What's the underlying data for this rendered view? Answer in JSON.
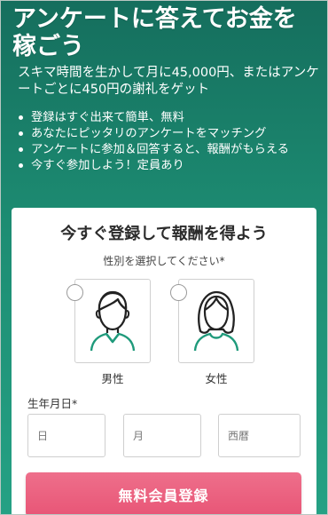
{
  "hero": {
    "headline": "アンケートに答えてお金を稼ごう",
    "subline": "スキマ時間を生かして月に45,000円、またはアンケートごとに450円の謝礼をゲット",
    "bullets": [
      "登録はすぐ出来て簡単、無料",
      "あなたにピッタリのアンケートをマッチング",
      "アンケートに参加＆回答すると、報酬がもらえる",
      "今すぐ参加しよう！定員あり"
    ]
  },
  "form": {
    "title": "今すぐ登録して報酬を得よう",
    "gender_label": "性別を選択してください",
    "required_mark": "*",
    "gender_options": [
      {
        "label": "男性",
        "icon": "male-avatar-icon"
      },
      {
        "label": "女性",
        "icon": "female-avatar-icon"
      }
    ],
    "dob_label": "生年月日",
    "dob_placeholders": {
      "day": "日",
      "month": "月",
      "year": "西暦"
    },
    "submit_label": "無料会員登録"
  },
  "colors": {
    "background_top": "#156e5d",
    "background_bottom": "#25a184",
    "icon_accent": "#1f9a7b",
    "button": "#e85576"
  }
}
